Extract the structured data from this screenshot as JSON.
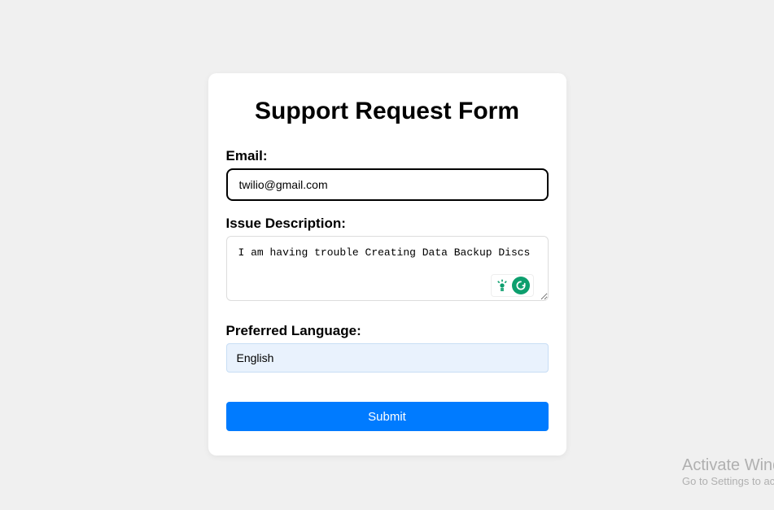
{
  "form": {
    "title": "Support Request Form",
    "email": {
      "label": "Email:",
      "value": "twilio@gmail.com"
    },
    "issue": {
      "label": "Issue Description:",
      "value": "I am having trouble Creating Data Backup Discs"
    },
    "language": {
      "label": "Preferred Language:",
      "selected": "English"
    },
    "submit_label": "Submit"
  },
  "watermark": {
    "title": "Activate Windows",
    "subtitle": "Go to Settings to activate Windows."
  }
}
